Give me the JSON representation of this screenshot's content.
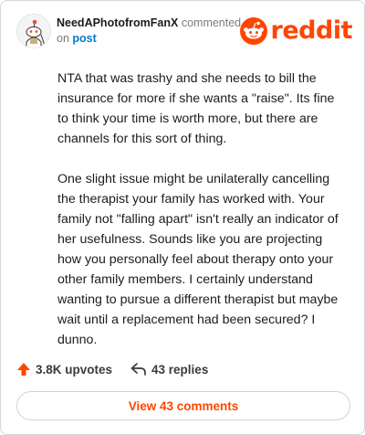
{
  "comment": {
    "username": "NeedAPhotofromFanX",
    "action_text": "commented",
    "on_text": "on",
    "post_link": "post",
    "paragraphs": [
      "NTA that was trashy and she needs to bill the insurance for more if she wants a \"raise\". Its fine to think your time is worth more, but there are channels for this sort of thing.",
      "One slight issue might be unilaterally cancelling the therapist your family has worked with. Your family not \"falling apart\" isn't really an indicator of her usefulness. Sounds like you are projecting how you personally feel about therapy onto your other family members. I certainly understand wanting to pursue a different therapist but maybe wait until a replacement had been secured? I dunno."
    ]
  },
  "brand": {
    "name": "reddit",
    "logo_icon": "reddit-snoo-icon",
    "color": "#ff4500"
  },
  "actions": {
    "upvotes": "3.8K upvotes",
    "replies": "43 replies",
    "upvote_icon": "upvote-arrow-icon",
    "reply_icon": "reply-arrow-icon",
    "upvote_color": "#ff4500"
  },
  "view_button": {
    "label": "View 43 comments"
  }
}
